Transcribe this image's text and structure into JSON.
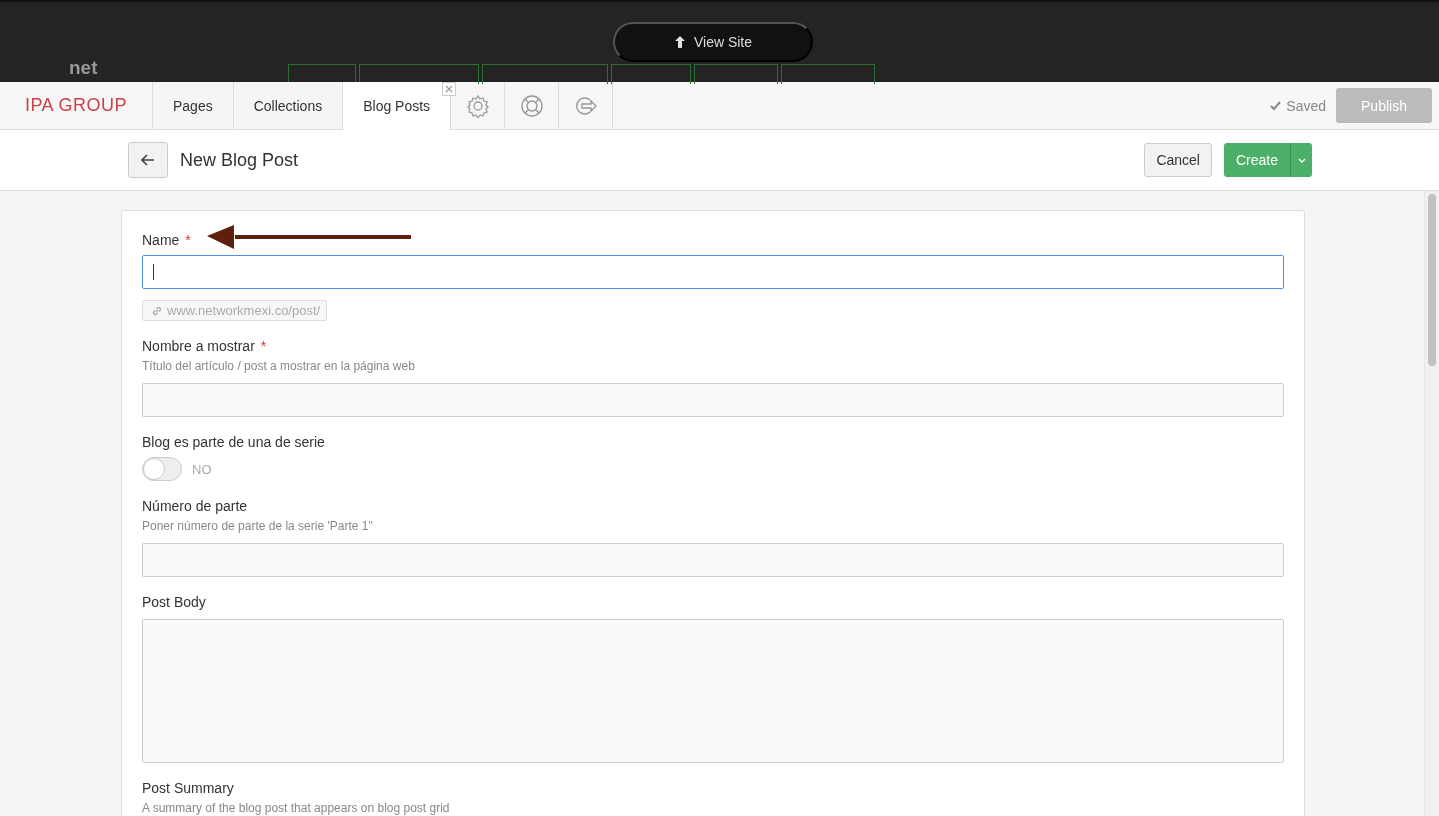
{
  "backdrop": {
    "logo": "net",
    "view_site": "View Site",
    "nav_items": [
      {
        "color": "#2f6b35"
      },
      {
        "color": "#2f6b35"
      },
      {
        "color": "#2f6b35"
      },
      {
        "color": "#2f6b35"
      },
      {
        "color": "#2f6b35"
      },
      {
        "color": "#2f6b35"
      }
    ]
  },
  "toolbar": {
    "brand": "IPA GROUP",
    "tabs": [
      {
        "label": "Pages",
        "selected": false,
        "closable": false
      },
      {
        "label": "Collections",
        "selected": false,
        "closable": false
      },
      {
        "label": "Blog Posts",
        "selected": true,
        "closable": true
      }
    ],
    "icon_tabs": [
      {
        "kind": "settings"
      },
      {
        "kind": "help"
      },
      {
        "kind": "logout"
      }
    ],
    "saved": "Saved",
    "publish": {
      "label": "Publish",
      "disabled": true
    }
  },
  "header": {
    "title": "New Blog Post",
    "cancel": "Cancel",
    "create": "Create"
  },
  "fields": [
    {
      "kind": "text",
      "label": "Name",
      "required_mark": "*",
      "focused": true,
      "slug": "www.networkmexi.co/post/"
    },
    {
      "kind": "text",
      "label": "Nombre a mostrar",
      "required_mark": "*",
      "focused": false,
      "hint": "Título del artículo / post a mostrar en la página web"
    },
    {
      "kind": "toggle",
      "label": "Blog es parte de una de serie",
      "on": false,
      "state_label": "NO"
    },
    {
      "kind": "text",
      "label": "Número de parte",
      "focused": false,
      "hint": "Poner número de parte de la serie 'Parte 1\""
    },
    {
      "kind": "textarea",
      "label": "Post Body"
    },
    {
      "kind": "label",
      "label": "Post Summary",
      "hint": "A summary of the blog post that appears on blog post grid"
    }
  ]
}
